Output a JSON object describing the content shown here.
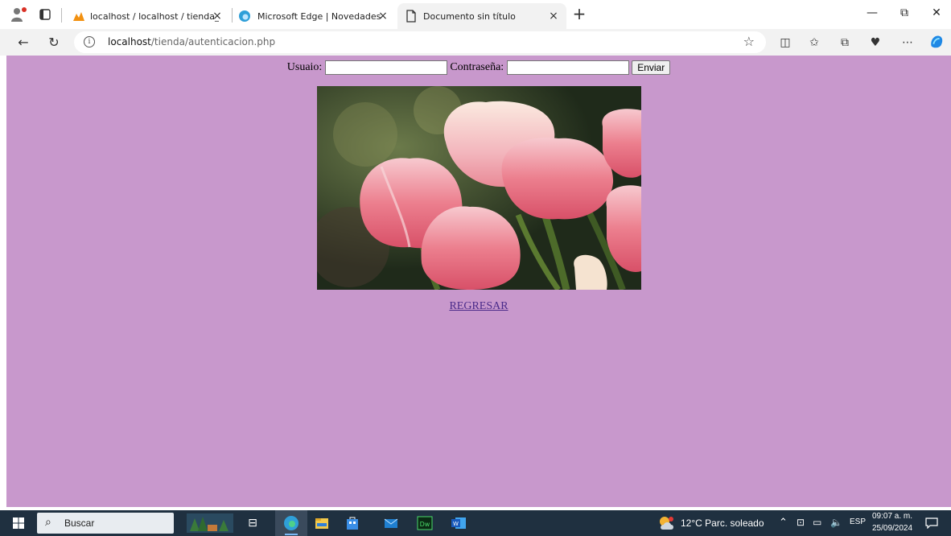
{
  "browser": {
    "tabs": [
      {
        "label": "localhost / localhost / tienda_aba",
        "close": "×"
      },
      {
        "label": "Microsoft Edge | Novedades",
        "close": "×"
      },
      {
        "label": "Documento sin título",
        "close": "×"
      }
    ],
    "new_tab": "+",
    "window_controls": {
      "minimize": "—",
      "restore": "⧉",
      "close": "✕"
    },
    "address": {
      "host": "localhost",
      "path": "/tienda/autenticacion.php"
    }
  },
  "page": {
    "background_color": "#c898cc",
    "form": {
      "user_label": "Usuaio:",
      "user_value": "",
      "password_label": "Contraseña:",
      "password_value": "",
      "submit_label": "Enviar"
    },
    "image": {
      "subject": "pink tulips photo"
    },
    "back_link": "REGRESAR"
  },
  "taskbar": {
    "search_placeholder": "Buscar",
    "weather": "12°C  Parc. soleado",
    "language": "ESP",
    "time": "09:07 a. m.",
    "date": "25/09/2024"
  }
}
